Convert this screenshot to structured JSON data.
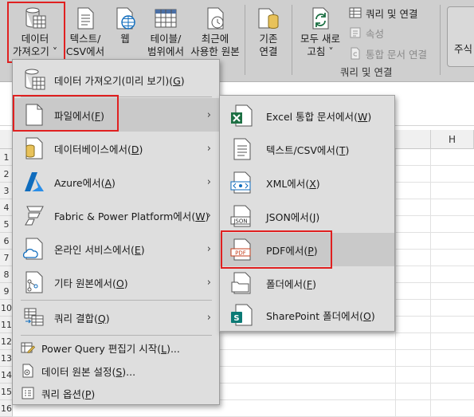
{
  "ribbon": {
    "get_data": {
      "line1": "데이터",
      "line2": "가져오기 ˅"
    },
    "text_csv": {
      "line1": "텍스트/",
      "line2": "CSV에서"
    },
    "web": {
      "line1": "웹"
    },
    "table_range": {
      "line1": "테이블/",
      "line2": "범위에서"
    },
    "recent_sources": {
      "line1": "최근에",
      "line2": "사용한 원본"
    },
    "existing_connections": {
      "line1": "기존",
      "line2": "연결"
    },
    "refresh_all": {
      "line1": "모두 새로",
      "line2": "고침 ˅"
    },
    "queries_connections": "쿼리 및 연결",
    "properties": "속성",
    "edit_links": "통합 문서 연결",
    "group_label": "쿼리 및 연결",
    "stocks": "주식"
  },
  "sheet": {
    "column_h": "H",
    "rows": [
      "1",
      "2",
      "3",
      "4",
      "5",
      "6",
      "7",
      "8",
      "9",
      "10",
      "11",
      "12",
      "13",
      "14",
      "15",
      "16"
    ]
  },
  "main_menu": {
    "items": [
      {
        "label": "데이터 가져오기(미리 보기)",
        "key": "G"
      },
      {
        "label": "파일에서",
        "key": "F"
      },
      {
        "label": "데이터베이스에서",
        "key": "D"
      },
      {
        "label": "Azure에서",
        "key": "A"
      },
      {
        "label": "Fabric & Power Platform에서",
        "key": "W"
      },
      {
        "label": "온라인 서비스에서",
        "key": "E"
      },
      {
        "label": "기타 원본에서",
        "key": "O"
      },
      {
        "label": "쿼리 결합",
        "key": "Q"
      }
    ],
    "small_items": [
      {
        "label": "Power Query 편집기 시작",
        "key": "L",
        "suffix": "..."
      },
      {
        "label": "데이터 원본 설정",
        "key": "S",
        "suffix": "..."
      },
      {
        "label": "쿼리 옵션",
        "key": "P",
        "suffix": ""
      }
    ],
    "arrow": "›"
  },
  "sub_menu": {
    "items": [
      {
        "label": "Excel 통합 문서에서",
        "key": "W"
      },
      {
        "label": "텍스트/CSV에서",
        "key": "T"
      },
      {
        "label": "XML에서",
        "key": "X"
      },
      {
        "label": "JSON에서",
        "key": "J"
      },
      {
        "label": "PDF에서",
        "key": "P"
      },
      {
        "label": "폴더에서",
        "key": "F"
      },
      {
        "label": "SharePoint 폴더에서",
        "key": "O"
      }
    ],
    "icon_text": {
      "json": "JSON",
      "pdf": "PDF"
    }
  },
  "colors": {
    "highlight_border": "#e02020",
    "excel_green": "#1d7044",
    "sharepoint_teal": "#0b7a75",
    "azure_blue": "#0f6cbd"
  }
}
